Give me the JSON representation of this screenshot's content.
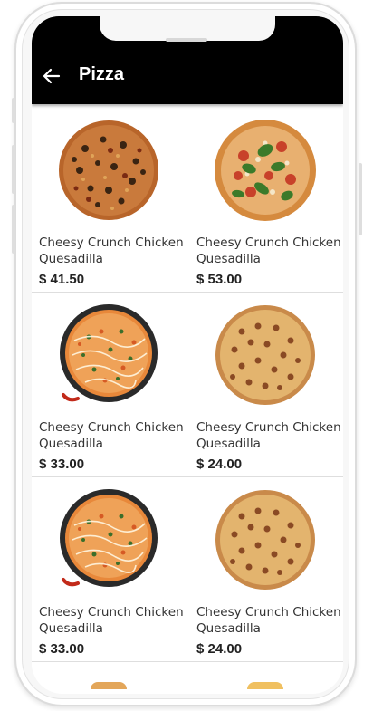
{
  "header": {
    "title": "Pizza",
    "back_icon": "arrow-left-icon"
  },
  "products": [
    {
      "name": "Cheesy Crunch Chicken Quesadilla",
      "price": "$ 41.50",
      "image": "pizza-olives"
    },
    {
      "name": "Cheesy Crunch Chicken Quesadilla",
      "price": "$ 53.00",
      "image": "pizza-basil"
    },
    {
      "name": "Cheesy Crunch Chicken Quesadilla",
      "price": "$ 33.00",
      "image": "pizza-drizzle"
    },
    {
      "name": "Cheesy Crunch Chicken Quesadilla",
      "price": "$ 24.00",
      "image": "pizza-sausage"
    },
    {
      "name": "Cheesy Crunch Chicken Quesadilla",
      "price": "$ 33.00",
      "image": "pizza-drizzle"
    },
    {
      "name": "Cheesy Crunch Chicken Quesadilla",
      "price": "$ 24.00",
      "image": "pizza-sausage"
    }
  ],
  "colors": {
    "appbar": "#000000",
    "card_border": "#dedede",
    "text": "#333333"
  }
}
